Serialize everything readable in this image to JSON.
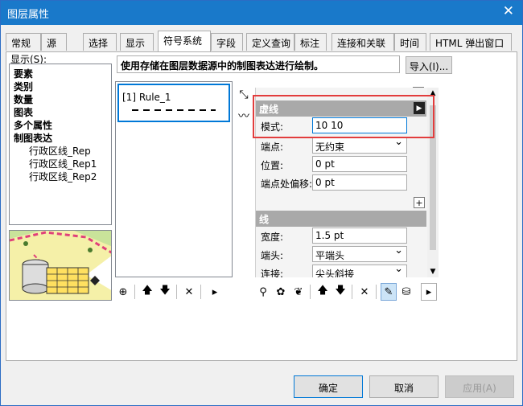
{
  "window": {
    "title": "图层属性"
  },
  "tabs": [
    "常规",
    "源",
    "选择",
    "显示",
    "符号系统",
    "字段",
    "定义查询",
    "标注",
    "连接和关联",
    "时间",
    "HTML 弹出窗口"
  ],
  "active_tab": "符号系统",
  "show_label": "显示(S):",
  "show_items": [
    "要素",
    "类别",
    "数量",
    "图表",
    "多个属性",
    "制图表达"
  ],
  "representation_subitems": [
    "行政区线_Rep",
    "行政区线_Rep1",
    "行政区线_Rep2"
  ],
  "description": "使用存储在图层数据源中的制图表达进行绘制。",
  "import_button": "导入(I)...",
  "rule": {
    "name": "[1] Rule_1"
  },
  "sections": {
    "dash": {
      "title": "虚线",
      "pattern_label": "模式:",
      "pattern_value": "10  10",
      "endpoint_label": "端点:",
      "endpoint_value": "无约束",
      "position_label": "位置:",
      "position_value": "0 pt",
      "offset_label": "端点处偏移:",
      "offset_value": "0 pt"
    },
    "line": {
      "title": "线",
      "width_label": "宽度:",
      "width_value": "1.5 pt",
      "cap_label": "端头:",
      "cap_value": "平端头",
      "join_label": "连接:",
      "join_value": "尖头斜接"
    }
  },
  "buttons": {
    "ok": "确定",
    "cancel": "取消",
    "apply": "应用(A)"
  },
  "toolbar_icons": {
    "rule_list": [
      "add-rule-icon",
      "move-up-icon",
      "move-down-icon",
      "delete-icon",
      "more-icon"
    ],
    "props": [
      "add-geometric-effect-icon",
      "add-marker-placement-icon",
      "add-fill-icon",
      "move-up-icon",
      "move-down-icon",
      "delete-icon",
      "line-layer-icon",
      "fill-layer-icon",
      "more-icon"
    ]
  },
  "colors": {
    "title_bar": "#1979ca",
    "highlight_box": "#e23d3d",
    "section_header": "#a9a9a9",
    "selection": "#0078d7"
  }
}
